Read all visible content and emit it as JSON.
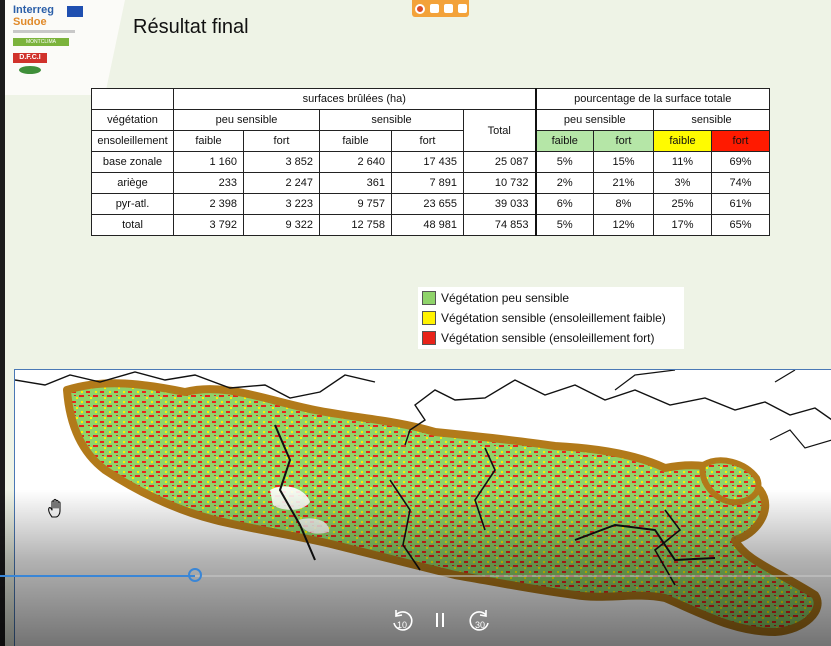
{
  "header": {
    "title": "Résultat final",
    "logos": {
      "interreg": "Interreg",
      "sudoe": "Sudoe",
      "montclima": "MONTCLIMA",
      "dfci": "D.F.C.I"
    }
  },
  "table": {
    "group_surfaces": "surfaces brûlées (ha)",
    "group_percent": "pourcentage de la surface totale",
    "label_vegetation": "végétation",
    "label_ensoleillement": "ensoleillement",
    "peu_sensible": "peu sensible",
    "sensible": "sensible",
    "total_header": "Total",
    "faible": "faible",
    "fort": "fort",
    "rows": [
      {
        "label": "base zonale",
        "v": [
          "1 160",
          "3 852",
          "2 640",
          "17 435",
          "25 087"
        ],
        "p": [
          "5%",
          "15%",
          "11%",
          "69%"
        ]
      },
      {
        "label": "ariège",
        "v": [
          "233",
          "2 247",
          "361",
          "7 891",
          "10 732"
        ],
        "p": [
          "2%",
          "21%",
          "3%",
          "74%"
        ]
      },
      {
        "label": "pyr-atl.",
        "v": [
          "2 398",
          "3 223",
          "9 757",
          "23 655",
          "39 033"
        ],
        "p": [
          "6%",
          "8%",
          "25%",
          "61%"
        ]
      },
      {
        "label": "total",
        "v": [
          "3 792",
          "9 322",
          "12 758",
          "48 981",
          "74 853"
        ],
        "p": [
          "5%",
          "12%",
          "17%",
          "65%"
        ]
      }
    ]
  },
  "legend": {
    "items": [
      {
        "label": "Végétation peu sensible",
        "color": "#8fd36a"
      },
      {
        "label": "Végétation sensible (ensoleillement faible)",
        "color": "#fff200"
      },
      {
        "label": "Végétation sensible (ensoleillement fort)",
        "color": "#e8231a"
      }
    ]
  },
  "colors": {
    "green_cell": "#b5e6a7",
    "yellow_cell": "#fffb00",
    "red_cell": "#ff1a00",
    "map_border": "#b27a1a",
    "map_green": "#8fd36a",
    "accent_blue": "#3a86d6",
    "toolbar_orange": "#f3a23a"
  },
  "player": {
    "progress": 0.235,
    "rewind_label": "10",
    "forward_label": "30"
  }
}
